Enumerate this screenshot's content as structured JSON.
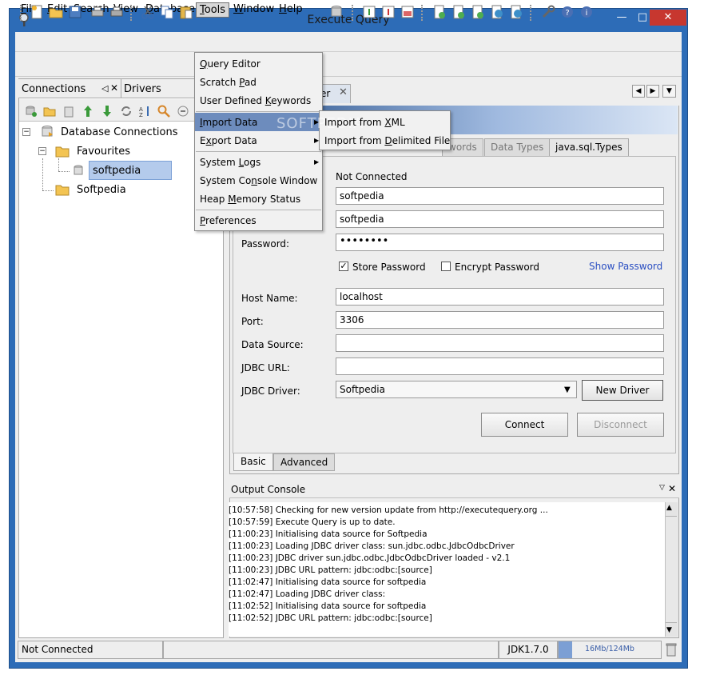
{
  "window": {
    "title": "Execute Query"
  },
  "menubar": [
    {
      "label": "File",
      "key": "F",
      "rest": "ile"
    },
    {
      "label": "Edit",
      "key": "E",
      "rest": "dit"
    },
    {
      "label": "Search",
      "key": "S",
      "rest": "earch"
    },
    {
      "label": "View",
      "key": "V",
      "rest": "iew"
    },
    {
      "label": "Database",
      "key": "D",
      "rest": "atabase"
    },
    {
      "label": "Tools",
      "key": "T",
      "rest": "ools"
    },
    {
      "label": "Window",
      "key": "W",
      "rest": "indow"
    },
    {
      "label": "Help",
      "key": "H",
      "rest": "elp"
    }
  ],
  "tools_menu": {
    "query_editor": {
      "pre": "",
      "key": "Q",
      "post": "uery Editor"
    },
    "scratch_pad": {
      "pre": "Scratch ",
      "key": "P",
      "post": "ad"
    },
    "user_keywords": {
      "pre": "User Defined ",
      "key": "K",
      "post": "eywords"
    },
    "import_data": {
      "pre": "",
      "key": "I",
      "post": "mport Data"
    },
    "export_data": {
      "pre": "E",
      "key": "x",
      "post": "port Data"
    },
    "system_logs": {
      "pre": "System ",
      "key": "L",
      "post": "ogs"
    },
    "system_console": {
      "pre": "System Co",
      "key": "n",
      "post": "sole Window"
    },
    "heap_memory": {
      "pre": "Heap ",
      "key": "M",
      "post": "emory Status"
    },
    "preferences": {
      "pre": "",
      "key": "P",
      "post": "references"
    }
  },
  "import_submenu": {
    "xml": {
      "pre": "Import from ",
      "key": "X",
      "post": "ML"
    },
    "delimited": {
      "pre": "Import from ",
      "key": "D",
      "post": "elimited File"
    }
  },
  "left_panel": {
    "tab_connections": "Connections",
    "tab_drivers": "Drivers",
    "tree": {
      "root": "Database Connections",
      "favourites": "Favourites",
      "fav_child": "softpedia",
      "other": "Softpedia"
    }
  },
  "right_panel": {
    "tab_suffix": "er",
    "subtabs": [
      "words",
      "Data Types",
      "java.sql.Types"
    ],
    "status_value": "Not Connected",
    "user_value": "softpedia",
    "schema_value": "softpedia",
    "password_label": "Password:",
    "password_value": "••••••••",
    "store_password": "Store Password",
    "encrypt_password": "Encrypt Password",
    "show_password": "Show Password",
    "host_label": "Host Name:",
    "host_value": "localhost",
    "port_label": "Port:",
    "port_value": "3306",
    "datasource_label": "Data Source:",
    "datasource_value": "",
    "jdbcurl_label": "JDBC URL:",
    "jdbcurl_value": "",
    "driver_label": "JDBC Driver:",
    "driver_value": "Softpedia",
    "new_driver": "New Driver",
    "connect": "Connect",
    "disconnect": "Disconnect",
    "bottom_tab_basic": "Basic",
    "bottom_tab_advanced": "Advanced"
  },
  "console": {
    "title": "Output Console",
    "lines": [
      "[10:57:58] Checking for new version update from http://executequery.org ...",
      "[10:57:59] Execute Query is up to date.",
      "[11:00:23] Initialising data source for Softpedia",
      "[11:00:23] Loading JDBC driver class: sun.jdbc.odbc.JdbcOdbcDriver",
      "[11:00:23] JDBC driver sun.jdbc.odbc.JdbcOdbcDriver loaded - v2.1",
      "[11:00:23] JDBC URL pattern: jdbc:odbc:[source]",
      "[11:02:47] Initialising data source for softpedia",
      "[11:02:47] Loading JDBC driver class:",
      "[11:02:52] Initialising data source for softpedia",
      "[11:02:52] JDBC URL pattern: jdbc:odbc:[source]"
    ]
  },
  "statusbar": {
    "status": "Not Connected",
    "jdk": "JDK1.7.0",
    "memory": "16Mb/124Mb"
  },
  "watermark": "SOFTPEDIA"
}
